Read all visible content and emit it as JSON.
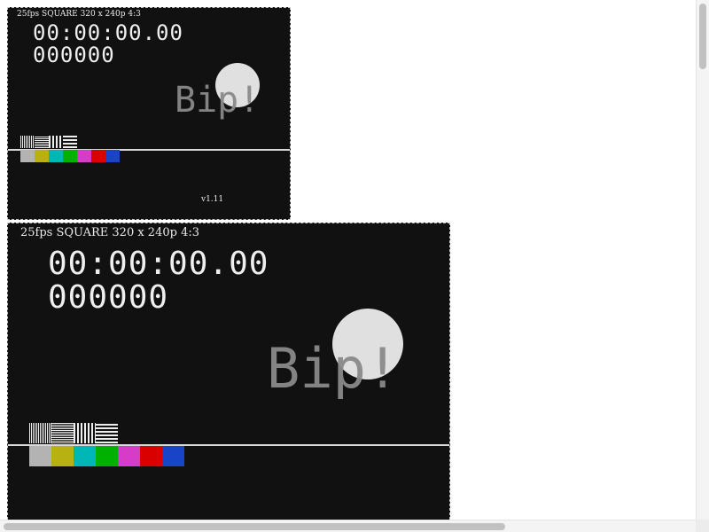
{
  "players": [
    {
      "hud_text": "25fps SQUARE 320 x 240p 4:3",
      "timecode": "00:00:00.00",
      "frame_counter": "000000",
      "bip_text": "Bip!",
      "version_text": "v1.11"
    },
    {
      "hud_text": "25fps SQUARE 320 x 240p 4:3",
      "timecode": "00:00:00.00",
      "frame_counter": "000000",
      "bip_text": "Bip!"
    }
  ],
  "color_bars": [
    "#b3b3b3",
    "#b7b112",
    "#00b7b7",
    "#00b100",
    "#d73cc9",
    "#db0000",
    "#1a44c8"
  ],
  "theme": {
    "page_background": "#ffffff",
    "video_background": "#111111",
    "text_color": "#efefef",
    "ball_color": "#e0e0e0",
    "bip_color": "#8a8a8a",
    "line_color": "#d9d9d9"
  }
}
